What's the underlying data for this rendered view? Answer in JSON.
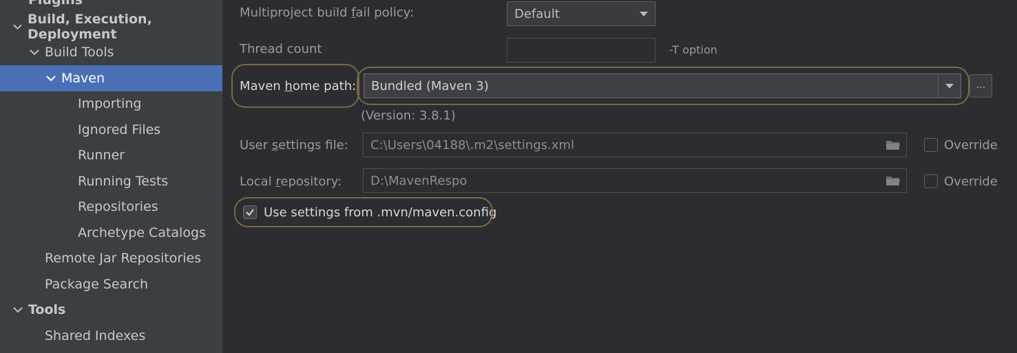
{
  "sidebar": {
    "items": [
      {
        "label": "Plugins"
      },
      {
        "label": "Build, Execution, Deployment"
      },
      {
        "label": "Build Tools"
      },
      {
        "label": "Maven"
      },
      {
        "label": "Importing"
      },
      {
        "label": "Ignored Files"
      },
      {
        "label": "Runner"
      },
      {
        "label": "Running Tests"
      },
      {
        "label": "Repositories"
      },
      {
        "label": "Archetype Catalogs"
      },
      {
        "label": "Remote Jar Repositories"
      },
      {
        "label": "Package Search"
      },
      {
        "label": "Tools"
      },
      {
        "label": "Shared Indexes"
      }
    ]
  },
  "form": {
    "fail_policy": {
      "label_pre": "Multiproject build ",
      "label_mn": "f",
      "label_post": "ail policy:",
      "value": "Default"
    },
    "thread_count": {
      "label": "Thread count",
      "value": "",
      "hint": "-T option"
    },
    "maven_home": {
      "label_pre": "Maven ",
      "label_mn": "h",
      "label_post": "ome path:",
      "value": "Bundled (Maven 3)",
      "browse_label": "...",
      "version": "(Version: 3.8.1)"
    },
    "user_settings": {
      "label_pre": "User ",
      "label_mn": "s",
      "label_post": "ettings file:",
      "value": "C:\\Users\\04188\\.m2\\settings.xml",
      "override_label": "Override",
      "override_checked": false
    },
    "local_repo": {
      "label_pre": "Local ",
      "label_mn": "r",
      "label_post": "epository:",
      "value": "D:\\MavenRespo",
      "override_label": "Override",
      "override_checked": false
    },
    "use_mvn_config": {
      "label": "Use settings from .mvn/maven.config",
      "checked": true
    }
  },
  "colors": {
    "sidebar_bg": "#3c3f41",
    "selection": "#4a6fb4",
    "highlight_outline": "#7a6a42",
    "main_bg": "#2b2d30"
  }
}
